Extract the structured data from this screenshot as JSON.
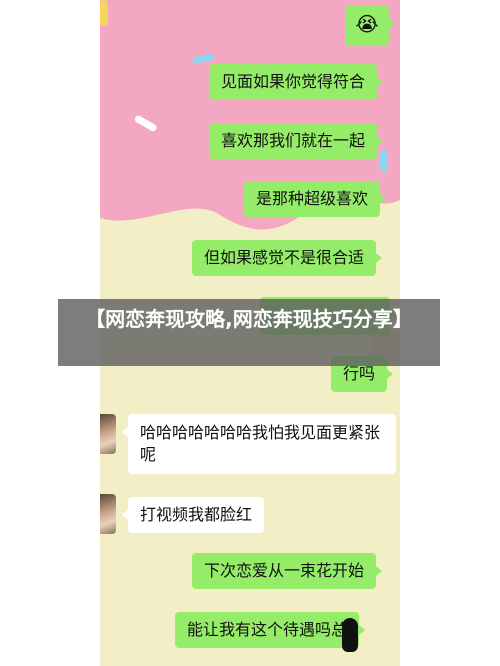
{
  "banner": {
    "title": "【网恋奔现攻略,网恋奔现技巧分享】"
  },
  "chat": {
    "emoji_bubble": "😭",
    "messages": [
      {
        "side": "right",
        "text": "见面如果你觉得符合"
      },
      {
        "side": "right",
        "text": "喜欢那我们就在一起"
      },
      {
        "side": "right",
        "text": "是那种超级喜欢"
      },
      {
        "side": "right",
        "text": "但如果感觉不是很合适"
      },
      {
        "side": "right",
        "text": "行吗"
      },
      {
        "side": "left",
        "text": "哈哈哈哈哈哈哈我怕我见面更紧张呢"
      },
      {
        "side": "left",
        "text": "打视频我都脸红"
      },
      {
        "side": "right",
        "text": "下次恋爱从一束花开始"
      },
      {
        "side": "right",
        "text": "能让我有这个待遇吗总"
      }
    ]
  },
  "colors": {
    "bubble_sent": "#95ec69",
    "bubble_received": "#ffffff",
    "bg_pink": "#f4a7c3",
    "bg_cream": "#f2efc7",
    "banner_bg": "#606060"
  }
}
